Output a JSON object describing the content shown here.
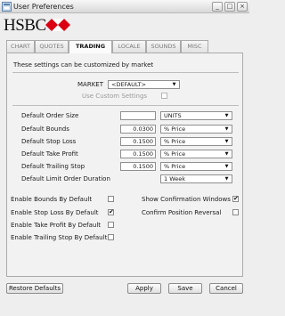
{
  "window": {
    "title": "User Preferences",
    "controls": {
      "minimize": "_",
      "maximize": "□",
      "close": "×"
    }
  },
  "logo": {
    "text": "HSBC",
    "brand_color": "#db0011",
    "icon": "hsbc-hexagon-icon"
  },
  "tabs": [
    {
      "label": "CHART",
      "active": false
    },
    {
      "label": "QUOTES",
      "active": false
    },
    {
      "label": "TRADING",
      "active": true
    },
    {
      "label": "LOCALE",
      "active": false
    },
    {
      "label": "SOUNDS",
      "active": false
    },
    {
      "label": "MISC",
      "active": false
    }
  ],
  "trading": {
    "intro": "These settings can be customized by market",
    "market": {
      "label": "MARKET",
      "value": "<DEFAULT>"
    },
    "use_custom": {
      "label": "Use Custom Settings",
      "checked": false
    },
    "rows": [
      {
        "label": "Default Order Size",
        "value": "",
        "unit": "UNITS"
      },
      {
        "label": "Default Bounds",
        "value": "0.0300",
        "unit": "% Price"
      },
      {
        "label": "Default Stop Loss",
        "value": "0.1500",
        "unit": "% Price"
      },
      {
        "label": "Default Take Profit",
        "value": "0.1500",
        "unit": "% Price"
      },
      {
        "label": "Default Trailing Stop",
        "value": "0.1500",
        "unit": "% Price"
      }
    ],
    "limit_duration": {
      "label": "Default Limit Order Duration",
      "value": "1 Week"
    }
  },
  "defaults": {
    "left": [
      {
        "label": "Enable Bounds By Default",
        "checked": false
      },
      {
        "label": "Enable Stop Loss By Default",
        "checked": true
      },
      {
        "label": "Enable Take Profit By Default",
        "checked": false
      },
      {
        "label": "Enable Trailing Stop By Default",
        "checked": false
      }
    ],
    "right": [
      {
        "label": "Show Confirmation Windows",
        "checked": true
      },
      {
        "label": "Confirm Position Reversal",
        "checked": false
      }
    ]
  },
  "buttons": {
    "restore": "Restore Defaults",
    "apply": "Apply",
    "save": "Save",
    "cancel": "Cancel"
  },
  "check_mark": "✔",
  "dropdown_arrow": "▼"
}
